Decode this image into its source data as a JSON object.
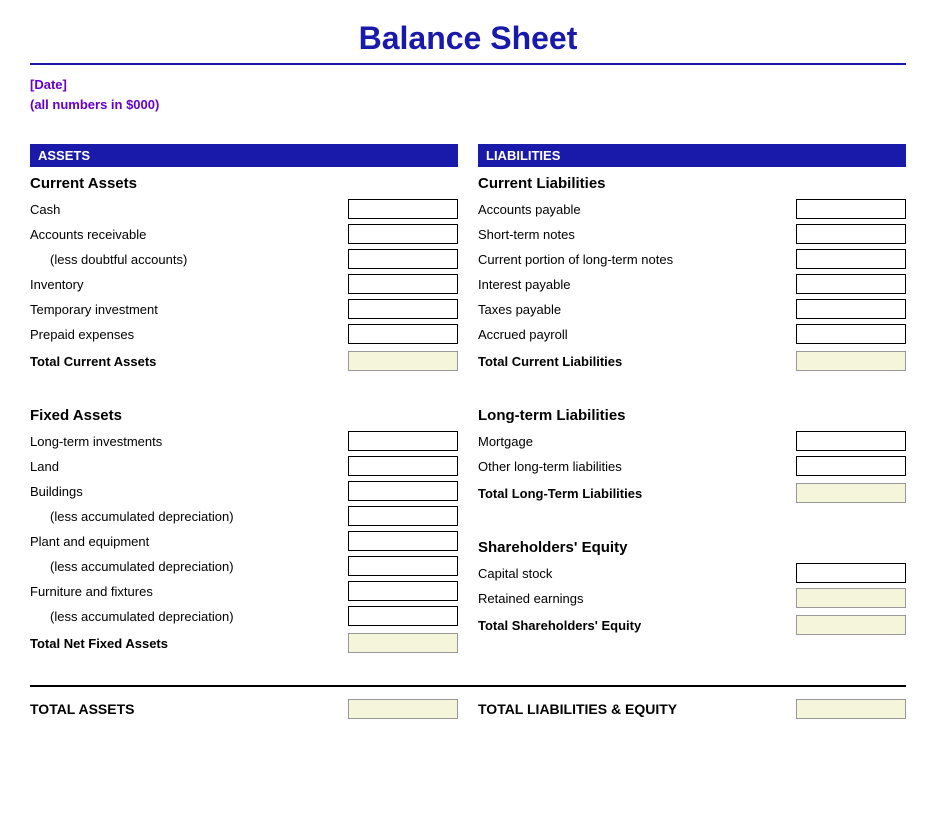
{
  "title": "Balance Sheet",
  "subtitle_line1": "[Date]",
  "subtitle_line2": "(all numbers in $000)",
  "assets": {
    "header": "ASSETS",
    "current_assets": {
      "title": "Current Assets",
      "items": [
        {
          "label": "Cash",
          "indent": false
        },
        {
          "label": "Accounts receivable",
          "indent": false
        },
        {
          "label": "(less doubtful accounts)",
          "indent": true
        },
        {
          "label": "Inventory",
          "indent": false
        },
        {
          "label": "Temporary investment",
          "indent": false
        },
        {
          "label": "Prepaid expenses",
          "indent": false
        }
      ],
      "total_label": "Total Current Assets"
    },
    "fixed_assets": {
      "title": "Fixed Assets",
      "items": [
        {
          "label": "Long-term investments",
          "indent": false
        },
        {
          "label": "Land",
          "indent": false
        },
        {
          "label": "Buildings",
          "indent": false
        },
        {
          "label": "(less accumulated depreciation)",
          "indent": true
        },
        {
          "label": "Plant and equipment",
          "indent": false
        },
        {
          "label": "(less accumulated depreciation)",
          "indent": true
        },
        {
          "label": "Furniture and fixtures",
          "indent": false
        },
        {
          "label": "(less accumulated depreciation)",
          "indent": true
        }
      ],
      "total_label": "Total Net Fixed Assets"
    },
    "total_label": "TOTAL ASSETS"
  },
  "liabilities": {
    "header": "LIABILITIES",
    "current_liabilities": {
      "title": "Current Liabilities",
      "items": [
        {
          "label": "Accounts payable",
          "indent": false
        },
        {
          "label": "Short-term notes",
          "indent": false
        },
        {
          "label": "Current portion of long-term notes",
          "indent": false
        },
        {
          "label": "Interest payable",
          "indent": false
        },
        {
          "label": "Taxes payable",
          "indent": false
        },
        {
          "label": "Accrued payroll",
          "indent": false
        }
      ],
      "total_label": "Total Current Liabilities"
    },
    "longterm_liabilities": {
      "title": "Long-term Liabilities",
      "items": [
        {
          "label": "Mortgage",
          "indent": false
        },
        {
          "label": "Other long-term liabilities",
          "indent": false
        }
      ],
      "total_label": "Total Long-Term Liabilities"
    },
    "equity": {
      "title": "Shareholders' Equity",
      "items": [
        {
          "label": "Capital stock",
          "indent": false
        },
        {
          "label": "Retained earnings",
          "indent": false
        }
      ],
      "total_label": "Total Shareholders' Equity"
    },
    "total_label": "TOTAL LIABILITIES & EQUITY"
  }
}
